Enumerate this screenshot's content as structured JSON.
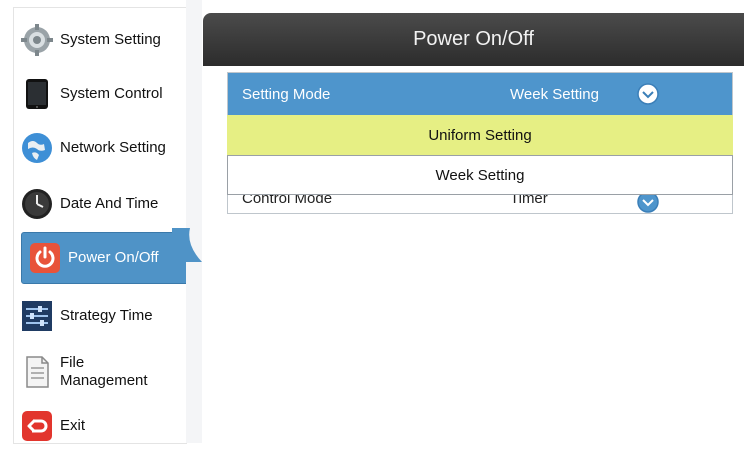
{
  "sidebar": {
    "items": [
      {
        "label": "System Setting",
        "icon": "gear-icon"
      },
      {
        "label": "System Control",
        "icon": "tablet-icon"
      },
      {
        "label": "Network Setting",
        "icon": "globe-icon"
      },
      {
        "label": "Date And Time",
        "icon": "clock-icon"
      },
      {
        "label": "Power On/Off",
        "icon": "power-icon",
        "active": true
      },
      {
        "label": "Strategy Time",
        "icon": "sliders-icon"
      },
      {
        "label": "File Management",
        "icon": "document-icon"
      },
      {
        "label": "Exit",
        "icon": "exit-icon"
      }
    ]
  },
  "header": {
    "title": "Power On/Off"
  },
  "settings": {
    "rows": [
      {
        "name": "Setting Mode",
        "value": "Week Setting",
        "selected": true
      },
      {
        "name": "Control Mode",
        "value": "Timer"
      }
    ]
  },
  "dropdown": {
    "options": [
      {
        "label": "Uniform Setting",
        "highlighted": true
      },
      {
        "label": "Week Setting"
      }
    ]
  },
  "colors": {
    "accent_blue": "#4e95cc",
    "highlight_yellow": "#e6ef84",
    "header_dark": "#333333",
    "power_red": "#e8533a"
  }
}
